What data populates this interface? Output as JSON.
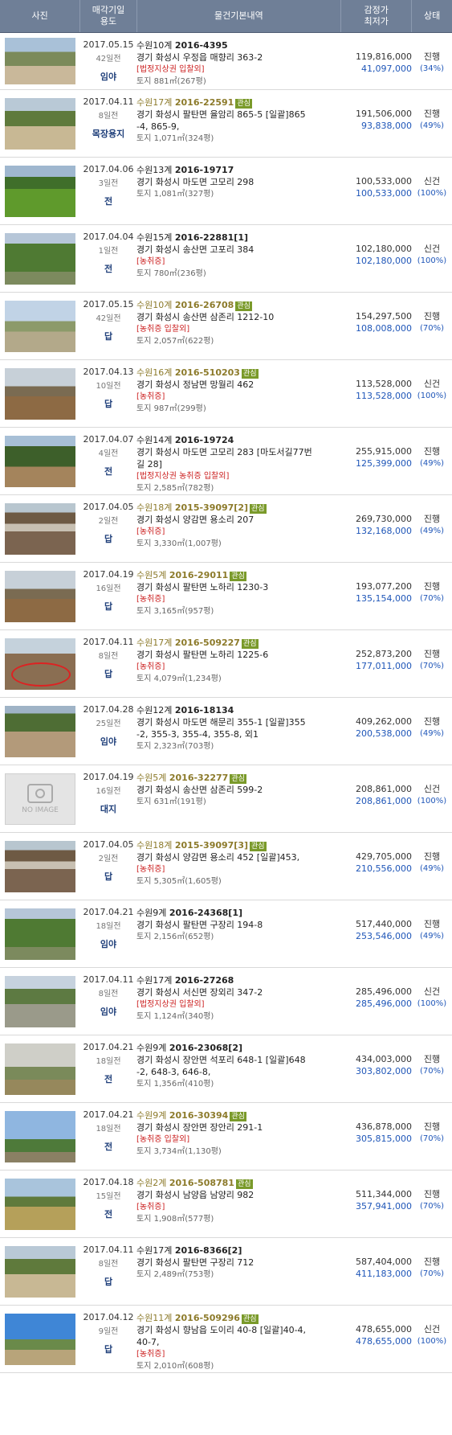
{
  "header": {
    "photo": "사진",
    "date_line1": "매각기일",
    "date_line2": "용도",
    "info": "물건기본내역",
    "price_line1": "감정가",
    "price_line2": "최저가",
    "status": "상태"
  },
  "items": [
    {
      "date": "2017.05.15",
      "ago": "42일전",
      "use": "임야",
      "court": "수원10계",
      "case": "2016-4395",
      "interest": false,
      "addr1": "경기 화성시 우정읍 매향리 363-2",
      "addr2": "",
      "tags": "[법정지상권 입찰외]",
      "land": "토지 881㎡(267평)",
      "appraisal": "119,816,000",
      "minimum": "41,097,000",
      "status": "진행",
      "pct": "(34%)",
      "photo": "rural-road"
    },
    {
      "date": "2017.04.11",
      "ago": "8일전",
      "use": "목장용지",
      "court": "수원17계",
      "case": "2016-22591",
      "interest": true,
      "addr1": "경기 화성시 팔탄면 율암리 865-5 [일괄]865",
      "addr2": "-4, 865-9,",
      "tags": "",
      "land": "토지 1,071㎡(324평)",
      "appraisal": "191,506,000",
      "minimum": "93,838,000",
      "status": "진행",
      "pct": "(49%)",
      "photo": "dirt-road"
    },
    {
      "date": "2017.04.06",
      "ago": "3일전",
      "use": "전",
      "court": "수원13계",
      "case": "2016-19717",
      "interest": false,
      "addr1": "경기 화성시 마도면 고모리 298",
      "addr2": "",
      "tags": "",
      "land": "토지 1,081㎡(327평)",
      "appraisal": "100,533,000",
      "minimum": "100,533,000",
      "status": "신건",
      "pct": "(100%)",
      "photo": "green-field"
    },
    {
      "date": "2017.04.04",
      "ago": "1일전",
      "use": "전",
      "court": "수원15계",
      "case": "2016-22881[1]",
      "interest": false,
      "addr1": "경기 화성시 송산면 고포리 384",
      "addr2": "",
      "tags": "[농취증]",
      "land": "토지 780㎡(236평)",
      "appraisal": "102,180,000",
      "minimum": "102,180,000",
      "status": "신건",
      "pct": "(100%)",
      "photo": "shrubs"
    },
    {
      "date": "2017.05.15",
      "ago": "42일전",
      "use": "답",
      "court": "수원10계",
      "case": "2016-26708",
      "interest": true,
      "addr1": "경기 화성시 송산면 삼존리 1212-10",
      "addr2": "",
      "tags": "[농취증 입찰외]",
      "land": "토지 2,057㎡(622평)",
      "appraisal": "154,297,500",
      "minimum": "108,008,000",
      "status": "진행",
      "pct": "(70%)",
      "photo": "open-land"
    },
    {
      "date": "2017.04.13",
      "ago": "10일전",
      "use": "답",
      "court": "수원16계",
      "case": "2016-510203",
      "interest": true,
      "addr1": "경기 화성시 정남면 망월리 462",
      "addr2": "",
      "tags": "[농취증]",
      "land": "토지 987㎡(299평)",
      "appraisal": "113,528,000",
      "minimum": "113,528,000",
      "status": "신건",
      "pct": "(100%)",
      "photo": "brown-field"
    },
    {
      "date": "2017.04.07",
      "ago": "4일전",
      "use": "전",
      "court": "수원14계",
      "case": "2016-19724",
      "interest": false,
      "addr1": "경기 화성시 마도면 고모리 283 [마도서길77번",
      "addr2": "길 28]",
      "tags": "[법정지상권 농취증 입찰외]",
      "land": "토지 2,585㎡(782평)",
      "appraisal": "255,915,000",
      "minimum": "125,399,000",
      "status": "진행",
      "pct": "(49%)",
      "photo": "trees-road"
    },
    {
      "date": "2017.04.05",
      "ago": "2일전",
      "use": "답",
      "court": "수원18계",
      "case": "2015-39097[2]",
      "interest": true,
      "addr1": "경기 화성시 양감면 용소리 207",
      "addr2": "",
      "tags": "[농취증]",
      "land": "토지 3,330㎡(1,007평)",
      "appraisal": "269,730,000",
      "minimum": "132,168,000",
      "status": "진행",
      "pct": "(49%)",
      "photo": "plowed"
    },
    {
      "date": "2017.04.19",
      "ago": "16일전",
      "use": "답",
      "court": "수원5계",
      "case": "2016-29011",
      "interest": true,
      "addr1": "경기 화성시 팔탄면 노하리 1230-3",
      "addr2": "",
      "tags": "[농취증]",
      "land": "토지 3,165㎡(957평)",
      "appraisal": "193,077,200",
      "minimum": "135,154,000",
      "status": "진행",
      "pct": "(70%)",
      "photo": "brown-field"
    },
    {
      "date": "2017.04.11",
      "ago": "8일전",
      "use": "답",
      "court": "수원17계",
      "case": "2016-509227",
      "interest": true,
      "addr1": "경기 화성시 팔탄면 노하리 1225-6",
      "addr2": "",
      "tags": "[농취증]",
      "land": "토지 4,079㎡(1,234평)",
      "appraisal": "252,873,200",
      "minimum": "177,011,000",
      "status": "진행",
      "pct": "(70%)",
      "photo": "circled"
    },
    {
      "date": "2017.04.28",
      "ago": "25일전",
      "use": "임야",
      "court": "수원12계",
      "case": "2016-18134",
      "interest": false,
      "addr1": "경기 화성시 마도면 해문리 355-1 [일괄]355",
      "addr2": "-2, 355-3, 355-4, 355-8, 외1",
      "tags": "",
      "land": "토지 2,323㎡(703평)",
      "appraisal": "409,262,000",
      "minimum": "200,538,000",
      "status": "진행",
      "pct": "(49%)",
      "photo": "hillside"
    },
    {
      "date": "2017.04.19",
      "ago": "16일전",
      "use": "대지",
      "court": "수원5계",
      "case": "2016-32277",
      "interest": true,
      "addr1": "경기 화성시 송산면 삼존리 599-2",
      "addr2": "",
      "tags": "",
      "land": "토지 631㎡(191평)",
      "appraisal": "208,861,000",
      "minimum": "208,861,000",
      "status": "신건",
      "pct": "(100%)",
      "photo": "none",
      "noimage": "NO IMAGE"
    },
    {
      "date": "2017.04.05",
      "ago": "2일전",
      "use": "답",
      "court": "수원18계",
      "case": "2015-39097[3]",
      "interest": true,
      "addr1": "경기 화성시 양감면 용소리 452 [일괄]453,",
      "addr2": "",
      "tags": "[농취증]",
      "land": "토지 5,305㎡(1,605평)",
      "appraisal": "429,705,000",
      "minimum": "210,556,000",
      "status": "진행",
      "pct": "(49%)",
      "photo": "plowed"
    },
    {
      "date": "2017.04.21",
      "ago": "18일전",
      "use": "임야",
      "court": "수원9계",
      "case": "2016-24368[1]",
      "interest": false,
      "addr1": "경기 화성시 팔탄면 구장리 194-8",
      "addr2": "",
      "tags": "",
      "land": "토지 2,156㎡(652평)",
      "appraisal": "517,440,000",
      "minimum": "253,546,000",
      "status": "진행",
      "pct": "(49%)",
      "photo": "shrubs"
    },
    {
      "date": "2017.04.11",
      "ago": "8일전",
      "use": "임야",
      "court": "수원17계",
      "case": "2016-27268",
      "interest": false,
      "addr1": "경기 화성시 서신면 장외리 347-2",
      "addr2": "",
      "tags": "[법정지상권 입찰외]",
      "land": "토지 1,124㎡(340평)",
      "appraisal": "285,496,000",
      "minimum": "285,496,000",
      "status": "신건",
      "pct": "(100%)",
      "photo": "village"
    },
    {
      "date": "2017.04.21",
      "ago": "18일전",
      "use": "전",
      "court": "수원9계",
      "case": "2016-23068[2]",
      "interest": false,
      "addr1": "경기 화성시 장안면 석포리 648-1 [일괄]648",
      "addr2": "-2, 648-3, 646-8,",
      "tags": "",
      "land": "토지 1,356㎡(410평)",
      "appraisal": "434,003,000",
      "minimum": "303,802,000",
      "status": "진행",
      "pct": "(70%)",
      "photo": "hazy-field"
    },
    {
      "date": "2017.04.21",
      "ago": "18일전",
      "use": "전",
      "court": "수원9계",
      "case": "2016-30394",
      "interest": true,
      "addr1": "경기 화성시 장안면 장안리 291-1",
      "addr2": "",
      "tags": "[농취증 입찰외]",
      "land": "토지 3,734㎡(1,130평)",
      "appraisal": "436,878,000",
      "minimum": "305,815,000",
      "status": "진행",
      "pct": "(70%)",
      "photo": "sky-field"
    },
    {
      "date": "2017.04.18",
      "ago": "15일전",
      "use": "전",
      "court": "수원2계",
      "case": "2016-508781",
      "interest": true,
      "addr1": "경기 화성시 남양읍 남양리 982",
      "addr2": "",
      "tags": "[농취증]",
      "land": "토지 1,908㎡(577평)",
      "appraisal": "511,344,000",
      "minimum": "357,941,000",
      "status": "진행",
      "pct": "(70%)",
      "photo": "dry-field"
    },
    {
      "date": "2017.04.11",
      "ago": "8일전",
      "use": "답",
      "court": "수원17계",
      "case": "2016-8366[2]",
      "interest": false,
      "addr1": "경기 화성시 팔탄면 구장리 712",
      "addr2": "",
      "tags": "",
      "land": "토지 2,489㎡(753평)",
      "appraisal": "587,404,000",
      "minimum": "411,183,000",
      "status": "진행",
      "pct": "(70%)",
      "photo": "dirt-road"
    },
    {
      "date": "2017.04.12",
      "ago": "9일전",
      "use": "답",
      "court": "수원11계",
      "case": "2016-509296",
      "interest": true,
      "addr1": "경기 화성시 향남읍 도이리 40-8 [일괄]40-4,",
      "addr2": "40-7,",
      "tags": "[농취증]",
      "land": "토지 2,010㎡(608평)",
      "appraisal": "478,655,000",
      "minimum": "478,655,000",
      "status": "신건",
      "pct": "(100%)",
      "photo": "blue-sky"
    }
  ],
  "interest_badge": "관심"
}
